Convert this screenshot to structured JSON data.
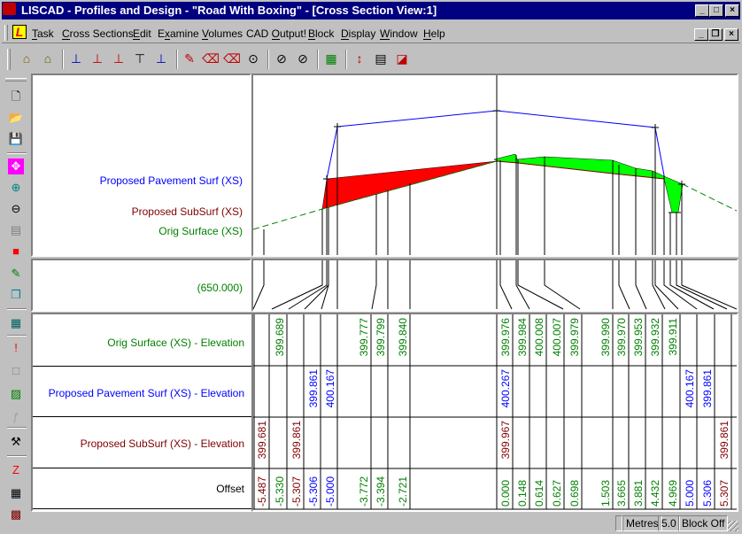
{
  "window": {
    "title": "LISCAD - Profiles and Design - \"Road With Boxing\" - [Cross Section View:1]"
  },
  "menu": [
    {
      "label": "Task",
      "u": "T"
    },
    {
      "label": "Cross Sections",
      "u": "C"
    },
    {
      "label": "Edit",
      "u": "E"
    },
    {
      "label": "Examine",
      "u": "x"
    },
    {
      "label": "Volumes",
      "u": "V"
    },
    {
      "label": "CAD Output!",
      "u": "O"
    },
    {
      "label": "Block",
      "u": "B"
    },
    {
      "label": "Display",
      "u": "D"
    },
    {
      "label": "Window",
      "u": "W"
    },
    {
      "label": "Help",
      "u": "H"
    }
  ],
  "colors": {
    "orig": "#008000",
    "pave": "#0000ff",
    "sub": "#800000",
    "cut": "#ff0000",
    "fill": "#00ff00",
    "titlebar": "#000080"
  },
  "labels": {
    "pave_surf": "Proposed Pavement Surf (XS)",
    "sub_surf": "Proposed SubSurf (XS)",
    "orig_surf": "Orig Surface (XS)",
    "chainage": "(650.000)"
  },
  "table": {
    "rows": {
      "orig": "Orig Surface (XS) - Elevation",
      "pave": "Proposed Pavement Surf (XS) - Elevation",
      "sub": "Proposed SubSurf (XS) - Elevation",
      "offset": "Offset"
    },
    "columns": [
      {
        "sub": "399.681",
        "offset": "-5.487",
        "series": "sub"
      },
      {
        "orig": "399.689",
        "offset": "-5.330",
        "series": "orig"
      },
      {
        "sub": "399.861",
        "offset": "-5.307",
        "series": "sub"
      },
      {
        "pave": "399.861",
        "offset": "-5.306",
        "series": "pave"
      },
      {
        "pave": "400.167",
        "offset": "-5.000",
        "series": "pave"
      },
      {
        "orig": "399.777",
        "offset": "-3.772",
        "series": "orig"
      },
      {
        "orig": "399.799",
        "offset": "-3.394",
        "series": "orig"
      },
      {
        "orig": "399.840",
        "offset": "-2.721",
        "series": "orig"
      },
      {},
      {
        "orig": "399.976",
        "pave": "400.267",
        "sub": "399.967",
        "offset": "0.000",
        "series": "orig"
      },
      {
        "orig": "399.984",
        "offset": "0.148",
        "series": "orig"
      },
      {
        "orig": "400.008",
        "offset": "0.614",
        "series": "orig"
      },
      {
        "orig": "400.007",
        "offset": "0.627",
        "series": "orig"
      },
      {
        "orig": "399.979",
        "offset": "0.698",
        "series": "orig"
      },
      {
        "orig": "399.990",
        "offset": "1.503",
        "series": "orig"
      },
      {
        "orig": "399.970",
        "offset": "3.665",
        "series": "orig"
      },
      {
        "orig": "399.953",
        "offset": "3.881",
        "series": "orig"
      },
      {
        "orig": "399.932",
        "offset": "4.432",
        "series": "orig"
      },
      {
        "orig": "399.911",
        "offset": "4.969",
        "series": "orig"
      },
      {
        "pave": "400.167",
        "offset": "5.000",
        "series": "pave"
      },
      {
        "pave": "399.861",
        "offset": "5.306",
        "series": "pave"
      },
      {
        "sub": "399.861",
        "offset": "5.307",
        "series": "sub"
      }
    ]
  },
  "status": {
    "units": "Metres",
    "scale": "5.0",
    "block": "Block Off"
  },
  "toolbar_icons": [
    "open-section-icon",
    "section-browse-icon",
    "design-point-icon",
    "design-raise-icon",
    "design-lower-icon",
    "design-top-icon",
    "design-center-icon",
    "edit-template-icon",
    "delete-point-icon",
    "delete-range-icon",
    "query-icon",
    "zoom-window-icon",
    "zoom-all-icon",
    "volume-icon",
    "profile-height-icon",
    "report-icon",
    "plot-icon"
  ],
  "left_toolbar_icons": [
    "new-file-icon",
    "open-folder-icon",
    "save-icon",
    "pan-icon",
    "zoom-in-icon",
    "zoom-out-icon",
    "window-icon",
    "color-icon",
    "pencil-icon",
    "copy-icon",
    "calculator-icon",
    "alert-icon",
    "select-icon",
    "hatch-icon",
    "function-icon",
    "tools-icon",
    "road-icon",
    "table-icon",
    "texture-icon"
  ]
}
